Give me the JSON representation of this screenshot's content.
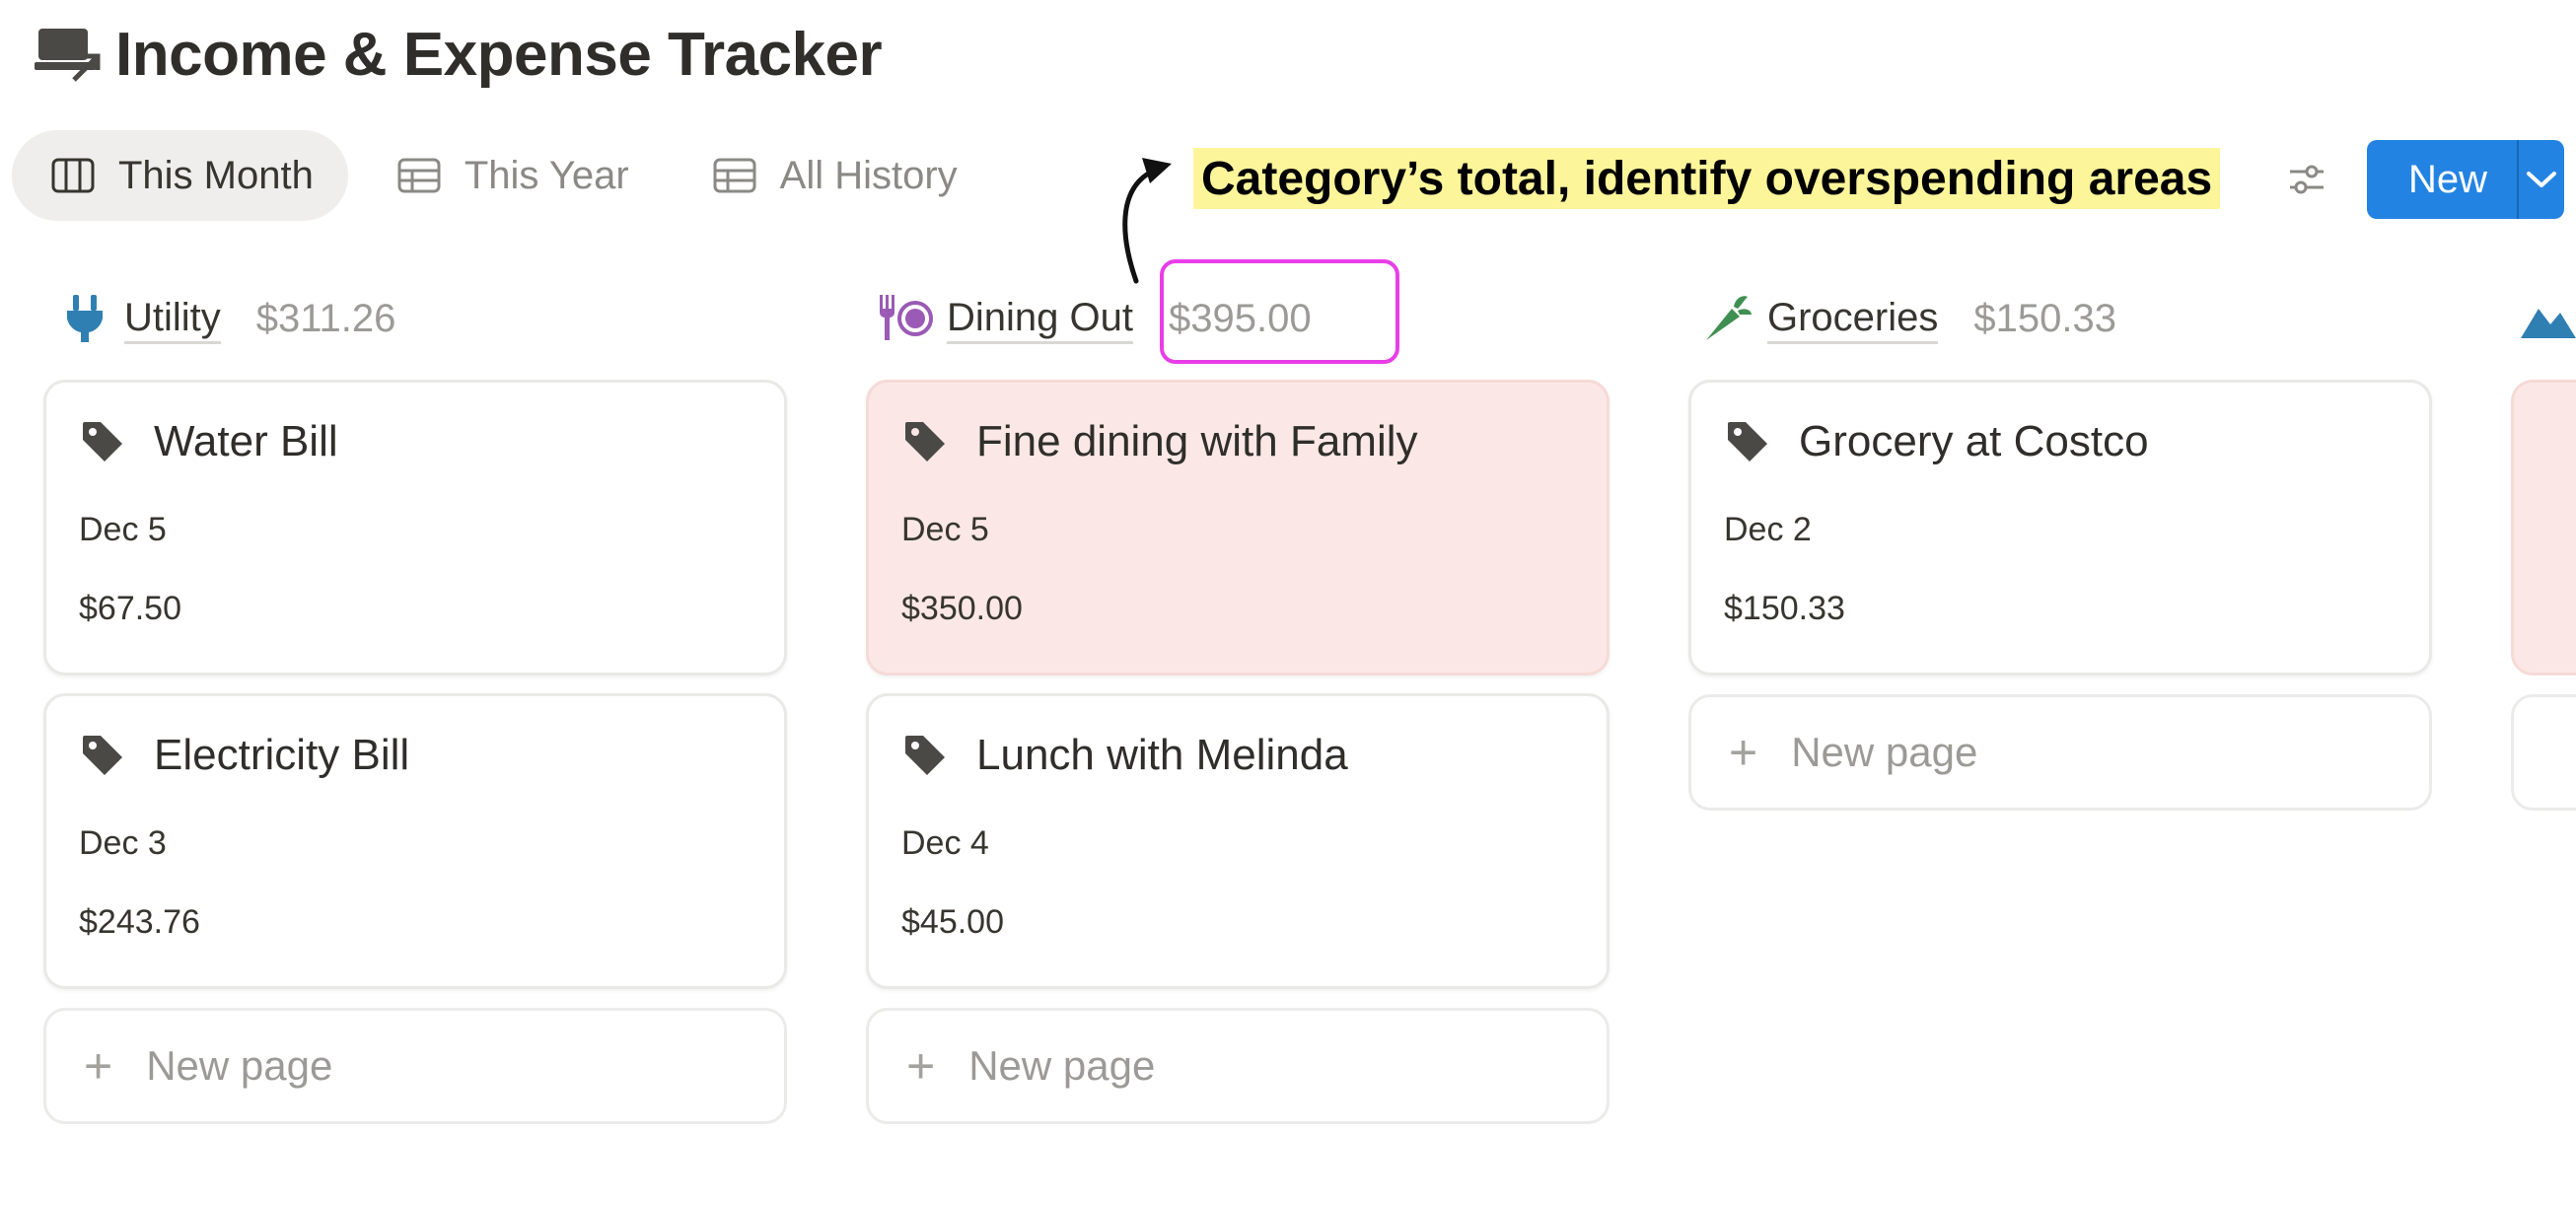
{
  "page": {
    "title": "Income & Expense Tracker"
  },
  "tabs": [
    {
      "label": "This Month",
      "active": true,
      "icon": "board-icon"
    },
    {
      "label": "This Year",
      "active": false,
      "icon": "table-icon"
    },
    {
      "label": "All History",
      "active": false,
      "icon": "table-icon"
    }
  ],
  "annotation": {
    "text": "Category’s total, identify overspending areas"
  },
  "toolbar": {
    "new_label": "New"
  },
  "columns": [
    {
      "name": "Utility",
      "total": "$311.26",
      "icon": "plug-icon",
      "cards": [
        {
          "title": "Water Bill",
          "date": "Dec 5",
          "amount": "$67.50"
        },
        {
          "title": "Electricity Bill",
          "date": "Dec 3",
          "amount": "$243.76"
        }
      ],
      "new_page": "New page"
    },
    {
      "name": "Dining Out",
      "total": "$395.00",
      "icon": "dining-icon",
      "cards": [
        {
          "title": "Fine dining with Family",
          "date": "Dec 5",
          "amount": "$350.00"
        },
        {
          "title": "Lunch with Melinda",
          "date": "Dec 4",
          "amount": "$45.00"
        }
      ],
      "new_page": "New page"
    },
    {
      "name": "Groceries",
      "total": "$150.33",
      "icon": "carrot-icon",
      "cards": [
        {
          "title": "Grocery at Costco",
          "date": "Dec 2",
          "amount": "$150.33"
        }
      ],
      "new_page": "New page"
    }
  ],
  "colors": {
    "accent": "#2383e2",
    "utility_icon": "#2f7fb3",
    "dining_icon": "#9a5ab5",
    "groceries_icon": "#3f8f52",
    "highlight_card": "#fbe8e6",
    "annotation_bg": "#fdf59a",
    "highlight_box": "#e83ee8"
  }
}
